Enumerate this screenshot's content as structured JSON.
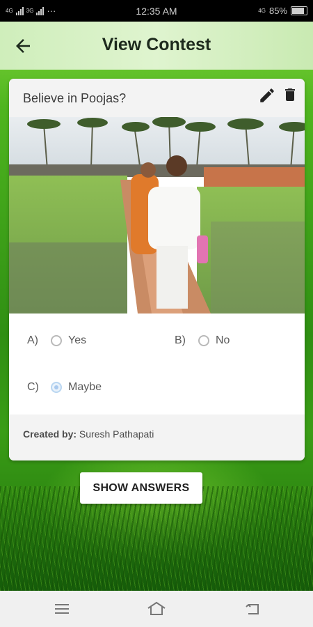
{
  "status_bar": {
    "network1": "4G",
    "network2": "3G",
    "dots": "···",
    "time": "12:35 AM",
    "network3": "4G",
    "battery_percent": "85%"
  },
  "app_bar": {
    "title": "View Contest",
    "back_icon": "arrow-left-icon"
  },
  "contest": {
    "question": "Believe in Poojas?",
    "actions": {
      "edit_icon": "pencil-icon",
      "delete_icon": "trash-icon"
    },
    "options": [
      {
        "letter": "A)",
        "label": "Yes",
        "selected": false
      },
      {
        "letter": "B)",
        "label": "No",
        "selected": false
      },
      {
        "letter": "C)",
        "label": "Maybe",
        "selected": true
      }
    ],
    "created_by_label": "Created by:",
    "created_by_name": "Suresh Pathapati"
  },
  "show_answers_label": "SHOW ANSWERS",
  "nav_bar": {
    "menu_icon": "menu-icon",
    "home_icon": "home-icon",
    "back_icon": "back-icon"
  },
  "colors": {
    "app_bar": "#d8f1c6",
    "selected_radio": "#a9c9ee"
  }
}
